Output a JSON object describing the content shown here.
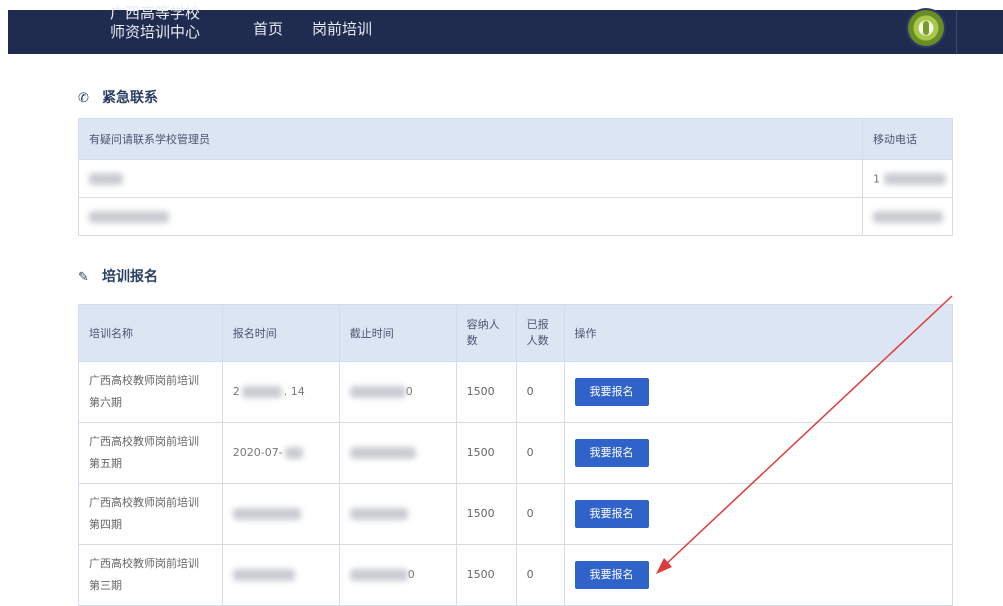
{
  "header": {
    "brand_line1": "广西高等学校",
    "brand_line2": "师资培训中心",
    "nav": [
      {
        "label": "首页"
      },
      {
        "label": "岗前培训"
      }
    ]
  },
  "contact_section": {
    "title": "紧急联系",
    "icon": "phone-icon",
    "columns": [
      "有疑问请联系学校管理员",
      "移动电话"
    ],
    "rows": [
      {
        "name_visible": "",
        "phone_visible": "1"
      },
      {
        "name_visible": "",
        "phone_visible": ""
      }
    ]
  },
  "training_section": {
    "title": "培训报名",
    "icon": "edit-icon",
    "columns": {
      "name": "培训名称",
      "start": "报名时间",
      "end": "截止时间",
      "capacity": "容纳人数",
      "enrolled": "已报人数",
      "action": "操作"
    },
    "rows": [
      {
        "name": "广西高校教师岗前培训第六期",
        "start_visible": "2",
        "start_tail": ". 14",
        "end_tail": "0",
        "capacity": "1500",
        "enrolled": "0",
        "button": "我要报名"
      },
      {
        "name": "广西高校教师岗前培训第五期",
        "start_visible": "2020-07-",
        "start_tail": "",
        "end_tail": "",
        "capacity": "1500",
        "enrolled": "0",
        "button": "我要报名"
      },
      {
        "name": "广西高校教师岗前培训第四期",
        "start_visible": "",
        "start_tail": "",
        "end_tail": "",
        "capacity": "1500",
        "enrolled": "0",
        "button": "我要报名"
      },
      {
        "name": "广西高校教师岗前培训第三期",
        "start_visible": "",
        "start_tail": "",
        "end_tail": "0",
        "capacity": "1500",
        "enrolled": "0",
        "button": "我要报名"
      }
    ]
  },
  "annotation": {
    "arrow_color": "#e03a3a"
  },
  "colors": {
    "header_bg": "#1f2b4f",
    "table_header_bg": "#dbe5f4",
    "button_bg": "#2f63c9"
  }
}
